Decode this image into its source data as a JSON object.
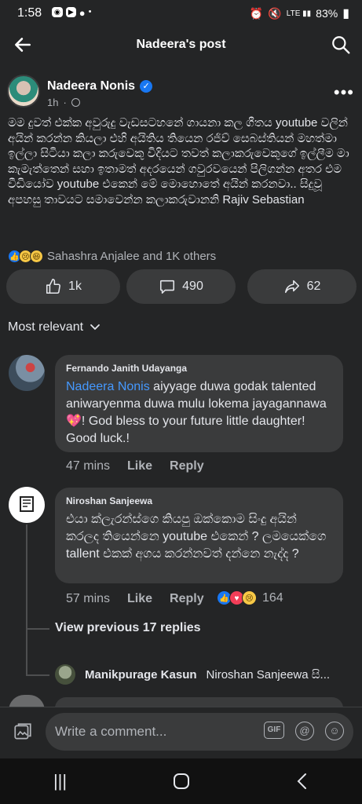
{
  "status": {
    "time": "1:58",
    "battery": "83%"
  },
  "header": {
    "title": "Nadeera's post"
  },
  "post": {
    "author": "Nadeera Nonis",
    "time": "1h",
    "text": "මම දුවත් එක්ක අවුරුදු වැඩසටහනේ ගායනා කල ගීතය youtube වලින් අයින් කරන්න කියලා එහි අයිතිය තියෙන රජිව් සෙබස්තියන් මහත්මා ඉල්ලා සිටියා කලා කරුවෙකු විදියට තවත් කලාකරුවෙකුගේ ඉල්ලීම මා කැමැත්තෙන් සහා ඉතාමත් අදරයෙන් ගවුරවයෙන් පිලිගන්න අතර එම වීඩියෝව youtube එකෙන් මේ මොහොතේ අයින් කරනවා.. සිදුවූ අපහසු තාවයට සමාවෙන්න කලාකරුවානනි Rajiv Sebastian",
    "reactions_text": "Sahashra Anjalee and 1K others",
    "likes": "1k",
    "comments": "490",
    "shares": "62"
  },
  "sort_label": "Most relevant",
  "comments": [
    {
      "name": "Fernando Janith Udayanga",
      "mention": "Nadeera Nonis",
      "text": " aiyyage duwa godak talented aniwaryenma duwa mulu lokema jayagannawa💖! God bless to your future little daughter! Good luck.!",
      "time": "47 mins",
      "like": "Like",
      "reply": "Reply"
    },
    {
      "name": "Niroshan Sanjeewa",
      "text": "එයා ක්ලැරන්ස්ගෙ කියපු ඔක්කොම සිංදු අයින් කරලද තියෙන්නෙ youtube එකෙන් ? ලමයෙක්ගෙ tallent එකක් අගය කරන්නවත් දන්නෙ නැද්ද ?",
      "time": "57 mins",
      "like": "Like",
      "reply": "Reply",
      "reaction_count": "164"
    }
  ],
  "view_replies": "View previous 17 replies",
  "reply_preview": {
    "name": "Manikpurage Kasun",
    "text": "Niroshan Sanjeewa සි..."
  },
  "composer": {
    "placeholder": "Write a comment..."
  },
  "icons": {
    "gif": "GIF",
    "at": "@",
    "emoji": "☺"
  }
}
